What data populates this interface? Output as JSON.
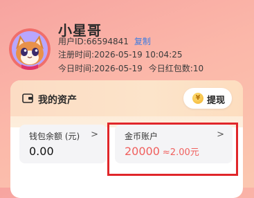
{
  "profile": {
    "username": "小星哥",
    "user_id_label": "用户ID:66594841",
    "copy_label": "复制",
    "register_time": "注册时间:2026-05-19 10:04:25",
    "today_time": "今日时间:2026-05-19",
    "today_red_packets": "今日红包数:10",
    "avatar_icon": "cartoon-cat-avatar-icon"
  },
  "assets": {
    "title": "我的资产",
    "wallet_icon": "wallet-icon",
    "withdraw_label": "提现",
    "coin_icon_glyph": "¥",
    "wallet_balance": {
      "label": "钱包余额 (元)",
      "value": "0.00"
    },
    "coin_account": {
      "label": "金币账户",
      "value": "20000",
      "approx": "≈2.00元"
    },
    "chevron": ">"
  },
  "colors": {
    "accent_red": "#f0605e",
    "link_blue": "#3d7be0",
    "highlight_border": "#e0262a"
  }
}
